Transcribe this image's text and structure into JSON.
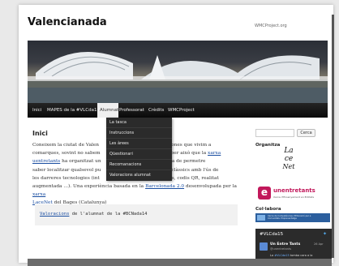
{
  "site": {
    "title": "Valencianada",
    "description": "WMCProject.org"
  },
  "nav": {
    "items": [
      {
        "label": "Inici"
      },
      {
        "label": "MAPES de la #VLCda15"
      },
      {
        "label": "Alumnat"
      },
      {
        "label": "Professorat"
      },
      {
        "label": "Crèdits"
      },
      {
        "label": "WMCProject"
      }
    ],
    "dropdown": [
      "La tasca",
      "Instruccions",
      "Les àrees",
      "Qüestionari",
      "Recomanacions",
      "Valoracions alumnat"
    ]
  },
  "post": {
    "title": "Inici",
    "line1_a": "Coneixem la ciutat de Valen",
    "line1_b": "r a aquelles persones que vivim a",
    "line2_a": "comarques, sovint no sabem",
    "line2_b": "e comercial. Es per això que la",
    "line2_link": "xarxa",
    "line3_link": "uentretants",
    "line3_a": " ha organitzat un",
    "line3_b": "ostres joves que els ha de permetre",
    "line4_a": "saber localitzar qualsevol pu",
    "line4_b": "ant els mitjans clàssics amb l'ús de",
    "line5_a": "les darreres tecnologies (int",
    "line5_b": "ió, xarxes socials, codis QR, realitat",
    "line6_a": "augmentada ...). Una experiència basada en la ",
    "line6_link": "Barcelonada 2.0",
    "line6_b": " desenvolupada per la ",
    "line6_link2": "xarxa",
    "line7_link": "LaceNet",
    "line7_b": " del Bages (Catalunya)"
  },
  "quote": {
    "link": "Valoracions",
    "text": " de l'alumnat de la #BCNada14"
  },
  "sidebar": {
    "search_placeholder": "",
    "search_button": "Cerca",
    "organitza_title": "Organitza",
    "logo_l1": "La",
    "logo_l2": "ce",
    "logo_l3": "Net",
    "unentretants_letter": "e",
    "unentretants_name": "unentretants",
    "unentretants_sub": "Xarxa d'Ensenyament en Entitats",
    "collabora_title": "Col·labora",
    "collab_line1": "Xarxa de Competències d'Educació per a",
    "collab_line2": "Comunitats d'Aprenentatge",
    "twitter_title": "#VLCda15",
    "tweet_author": "Un Entre Tants",
    "tweet_handle": "@unentretants",
    "tweet_date": "26 Apr",
    "tweet_text_a": "La ",
    "tweet_tag": "#VLCda15",
    "tweet_text_b": " tomba cara a la"
  },
  "colors": {
    "link": "#1a4ea1",
    "navbar": "#111111",
    "unentretants": "#c2185b"
  }
}
